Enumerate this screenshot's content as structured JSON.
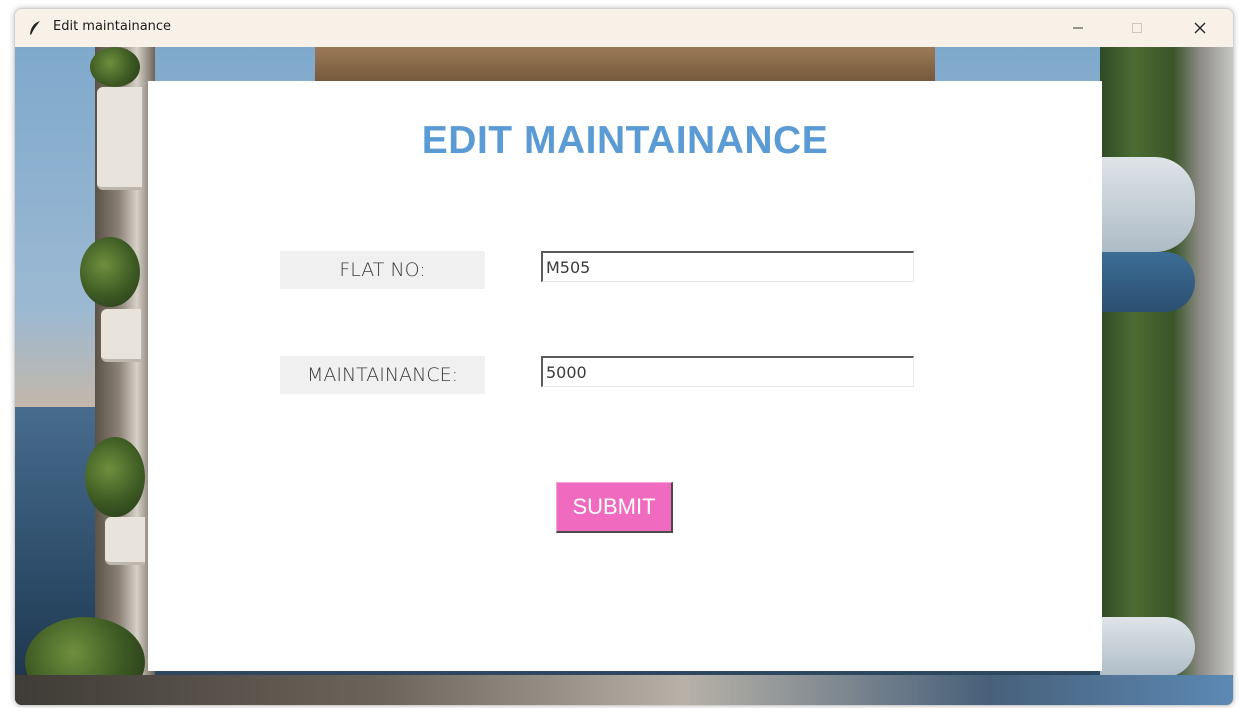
{
  "window": {
    "title": "Edit maintainance",
    "icon": "feather-icon"
  },
  "form": {
    "heading": "EDIT MAINTAINANCE",
    "heading_color": "#5b9bd5",
    "fields": [
      {
        "label": "FLAT NO:",
        "value": "M505"
      },
      {
        "label": "MAINTAINANCE:",
        "value": "5000"
      }
    ],
    "submit_label": "SUBMIT",
    "submit_color": "#f06bbf"
  }
}
